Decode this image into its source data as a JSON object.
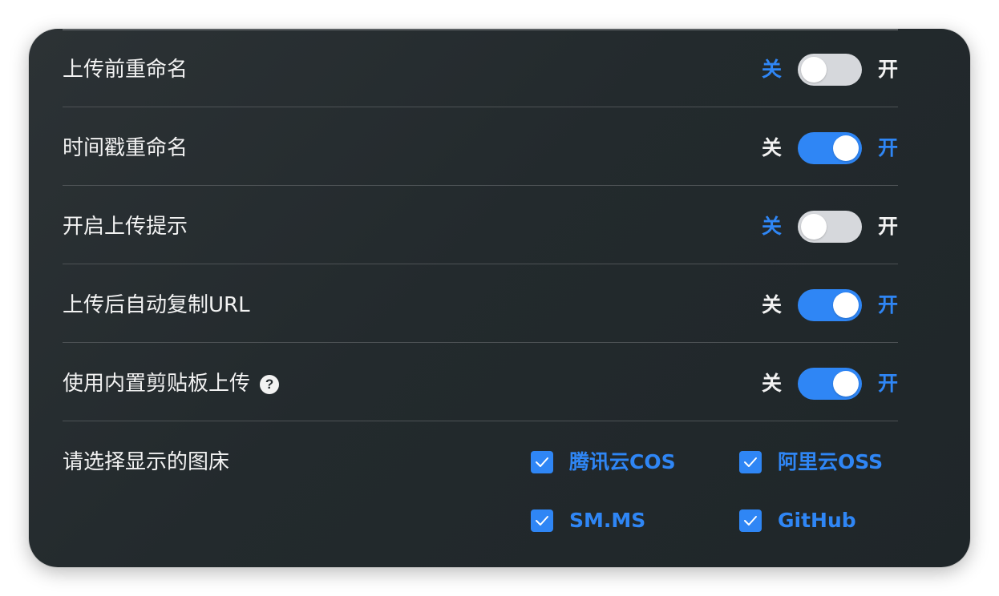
{
  "settings": {
    "rows": [
      {
        "label": "上传前重命名",
        "off_label": "关",
        "on_label": "开",
        "state": "off"
      },
      {
        "label": "时间戳重命名",
        "off_label": "关",
        "on_label": "开",
        "state": "on"
      },
      {
        "label": "开启上传提示",
        "off_label": "关",
        "on_label": "开",
        "state": "off"
      },
      {
        "label": "上传后自动复制URL",
        "off_label": "关",
        "on_label": "开",
        "state": "on"
      },
      {
        "label": "使用内置剪贴板上传",
        "off_label": "关",
        "on_label": "开",
        "state": "on",
        "help_icon": "?"
      }
    ],
    "bed_select": {
      "label": "请选择显示的图床",
      "options": [
        {
          "label": "腾讯云COS",
          "checked": true
        },
        {
          "label": "阿里云OSS",
          "checked": true
        },
        {
          "label": "SM.MS",
          "checked": true
        },
        {
          "label": "GitHub",
          "checked": true
        }
      ]
    }
  },
  "icons": {
    "help": "question-circle-icon",
    "check": "checkmark-icon"
  },
  "colors": {
    "accent": "#2f86f5",
    "background": "#232a2d",
    "text": "#f2f2f2",
    "switch_off": "#d6d8dc",
    "divider": "#4d5255"
  }
}
